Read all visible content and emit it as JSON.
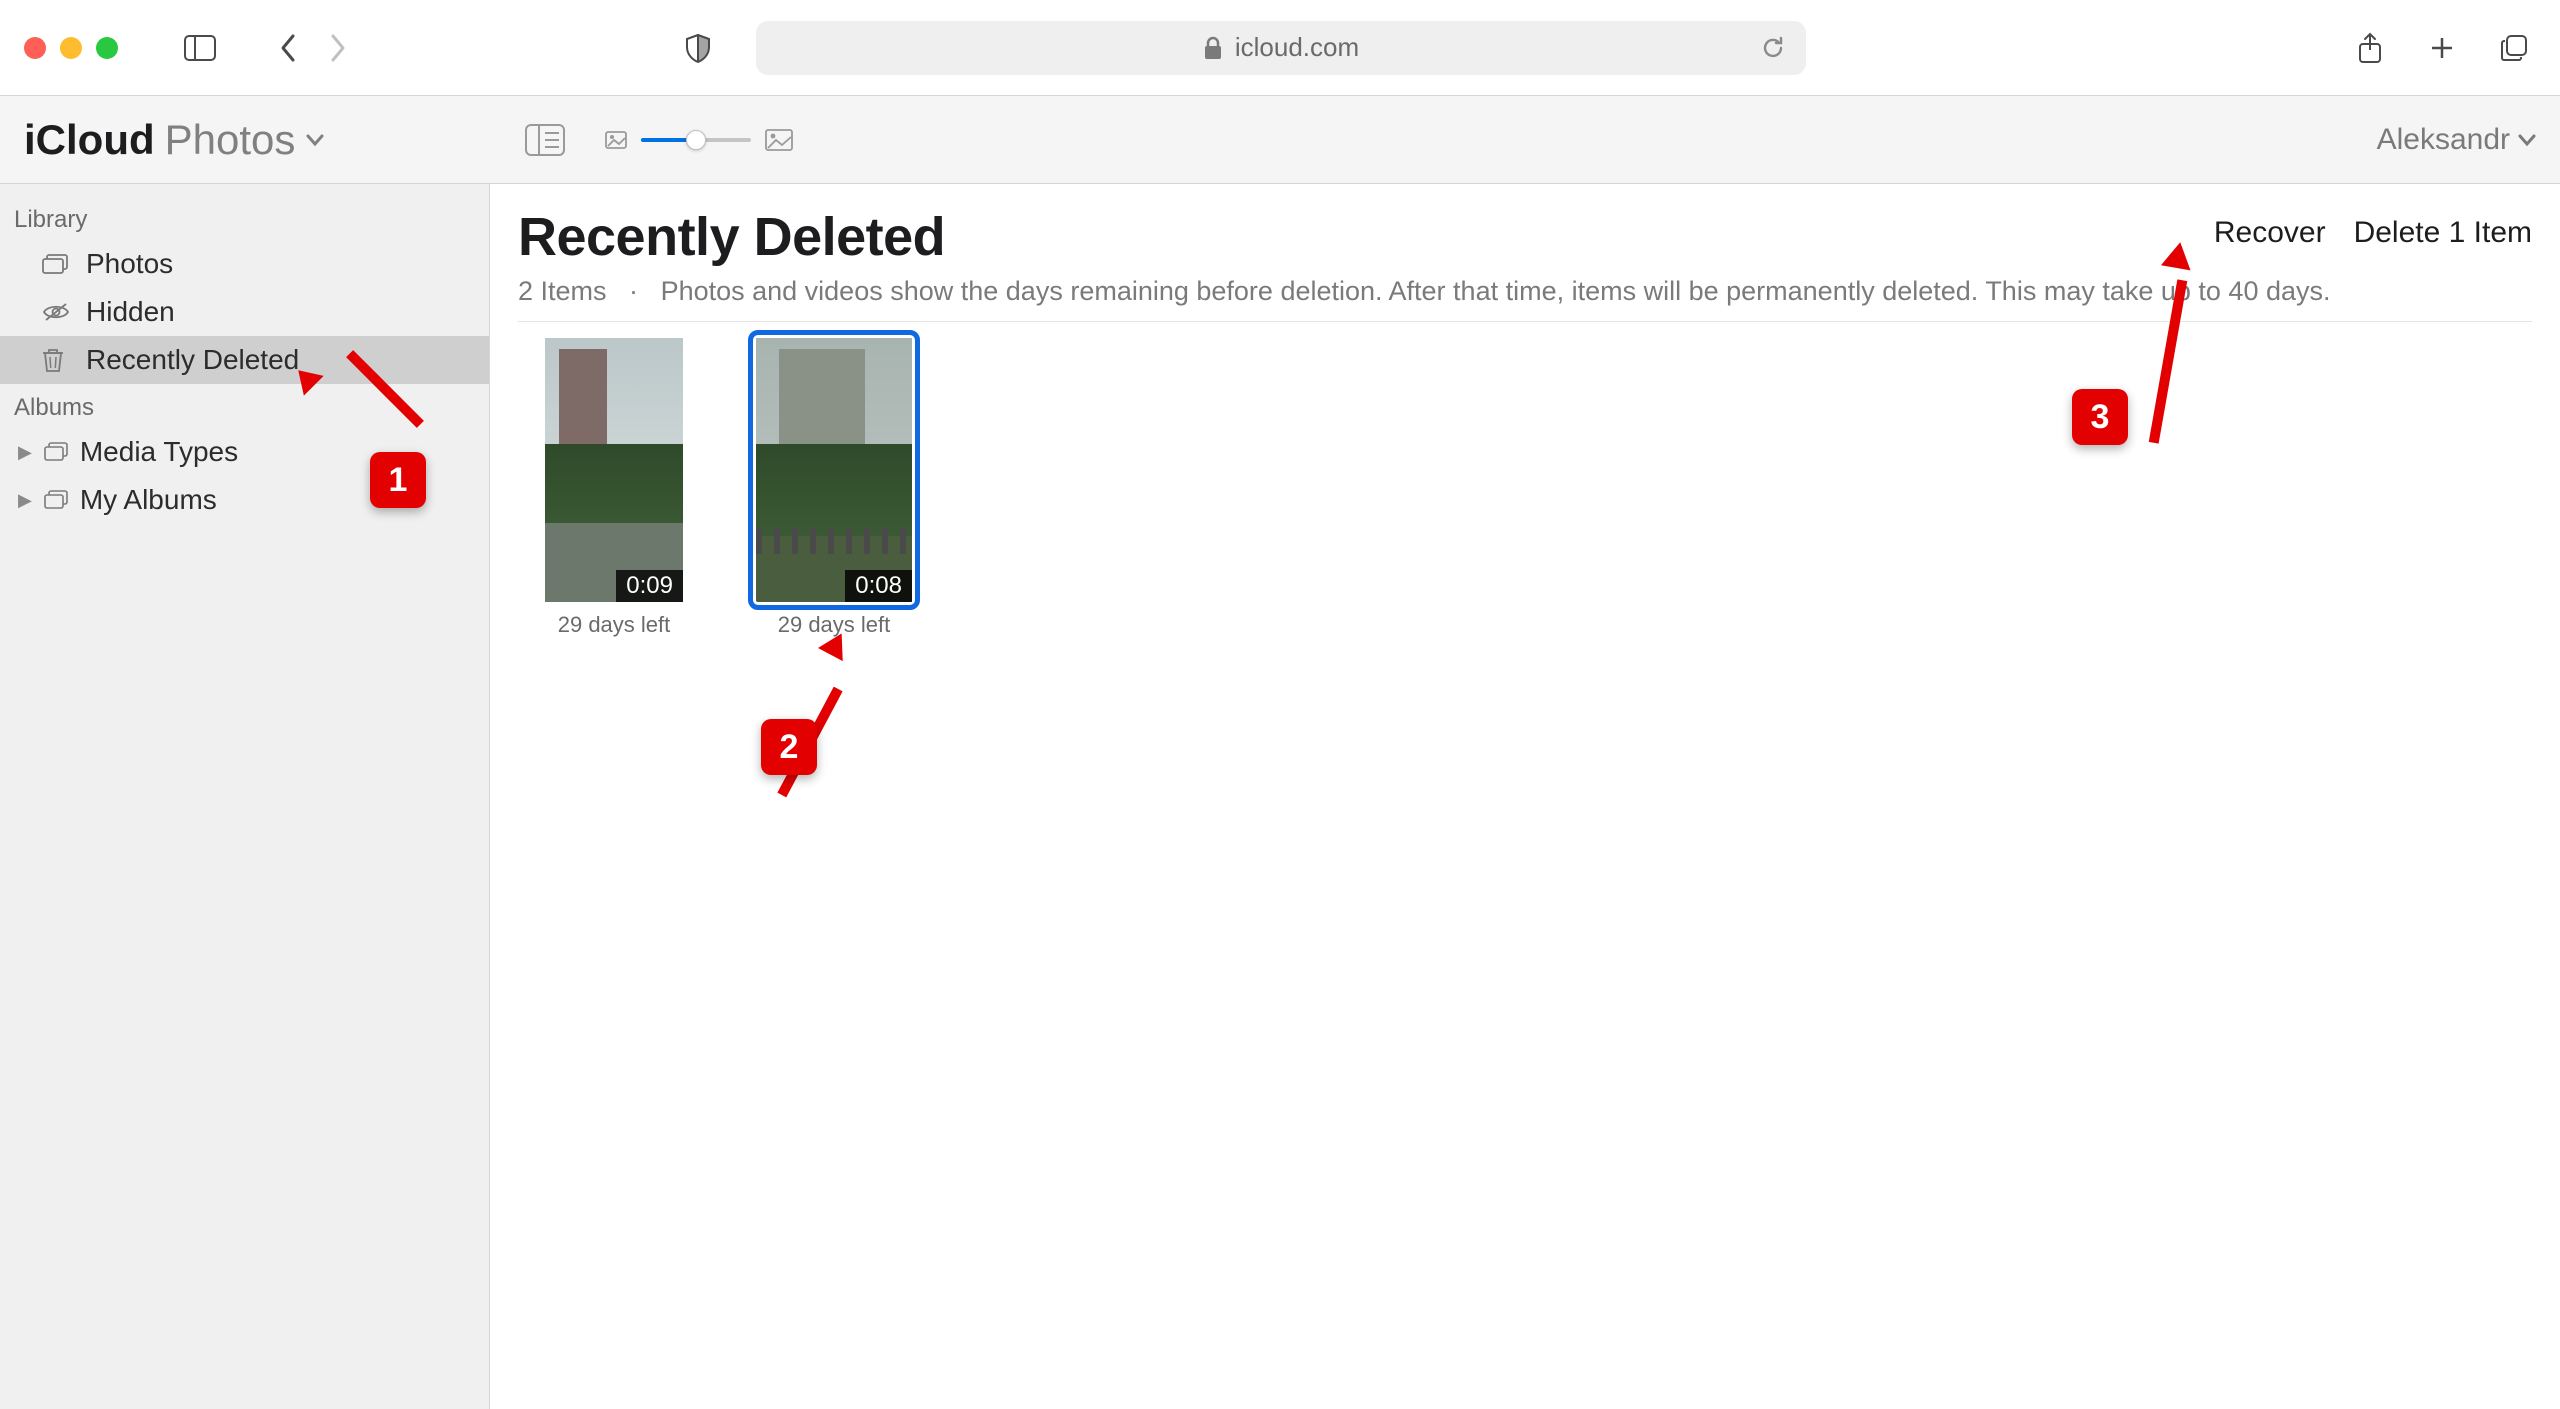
{
  "browser": {
    "url_domain": "icloud.com"
  },
  "brand": {
    "app": "iCloud",
    "section": "Photos"
  },
  "user": {
    "name": "Aleksandr"
  },
  "sidebar": {
    "library_label": "Library",
    "albums_label": "Albums",
    "items": [
      {
        "label": "Photos"
      },
      {
        "label": "Hidden"
      },
      {
        "label": "Recently Deleted"
      }
    ],
    "groups": [
      {
        "label": "Media Types"
      },
      {
        "label": "My Albums"
      }
    ]
  },
  "page": {
    "title": "Recently Deleted",
    "item_count_text": "2 Items",
    "separator": "·",
    "description": "Photos and videos show the days remaining before deletion. After that time, items will be permanently deleted. This may take up to 40 days."
  },
  "actions": {
    "recover": "Recover",
    "delete": "Delete 1 Item"
  },
  "thumbnails": [
    {
      "duration": "0:09",
      "caption": "29 days left",
      "selected": false
    },
    {
      "duration": "0:08",
      "caption": "29 days left",
      "selected": true
    }
  ],
  "annotations": {
    "one": "1",
    "two": "2",
    "three": "3"
  }
}
